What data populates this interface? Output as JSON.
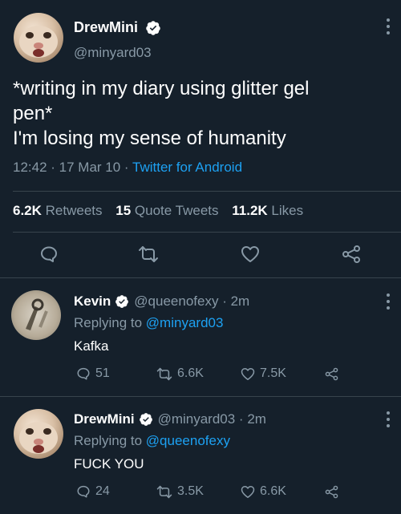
{
  "main_tweet": {
    "display_name": "DrewMini",
    "handle": "@minyard03",
    "text_line1": "*writing in my diary using glitter gel",
    "text_line2": "pen*",
    "text_line3": "I'm losing my sense of humanity",
    "time": "12:42",
    "date": "17 Mar 10",
    "source": "Twitter for Android",
    "retweets_count": "6.2K",
    "retweets_label": "Retweets",
    "quote_count": "15",
    "quote_label": "Quote Tweets",
    "likes_count": "11.2K",
    "likes_label": "Likes"
  },
  "replies": [
    {
      "display_name": "Kevin",
      "handle": "@queenofexy",
      "time": "2m",
      "replying_prefix": "Replying to",
      "replying_to": "@minyard03",
      "text": "Kafka",
      "replies": "51",
      "retweets": "6.6K",
      "likes": "7.5K"
    },
    {
      "display_name": "DrewMini",
      "handle": "@minyard03",
      "time": "2m",
      "replying_prefix": "Replying to",
      "replying_to": "@queenofexy",
      "text": "FUCK YOU",
      "replies": "24",
      "retweets": "3.5K",
      "likes": "6.6K"
    }
  ],
  "colors": {
    "background": "#15202b",
    "accent": "#1da1f2",
    "muted": "#8899a6",
    "divider": "#38444d"
  },
  "icons": [
    "verified-badge-icon",
    "more-vertical-icon",
    "reply-icon",
    "retweet-icon",
    "like-icon",
    "share-icon"
  ]
}
